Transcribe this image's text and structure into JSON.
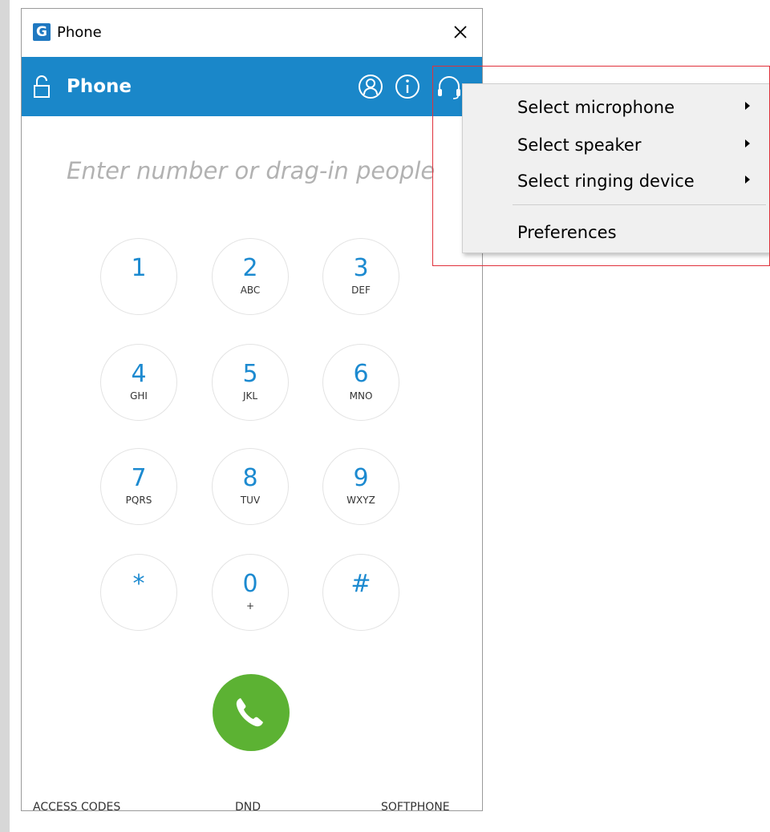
{
  "window": {
    "title": "Phone",
    "logo_letter": "G"
  },
  "header": {
    "title": "Phone",
    "icons": [
      "contacts-icon",
      "info-icon",
      "headset-icon"
    ]
  },
  "dialer": {
    "placeholder": "Enter number or drag-in people",
    "keys": [
      {
        "digit": "1",
        "letters": ""
      },
      {
        "digit": "2",
        "letters": "ABC"
      },
      {
        "digit": "3",
        "letters": "DEF"
      },
      {
        "digit": "4",
        "letters": "GHI"
      },
      {
        "digit": "5",
        "letters": "JKL"
      },
      {
        "digit": "6",
        "letters": "MNO"
      },
      {
        "digit": "7",
        "letters": "PQRS"
      },
      {
        "digit": "8",
        "letters": "TUV"
      },
      {
        "digit": "9",
        "letters": "WXYZ"
      },
      {
        "digit": "*",
        "letters": ""
      },
      {
        "digit": "0",
        "letters": "+"
      },
      {
        "digit": "#",
        "letters": ""
      }
    ]
  },
  "footer": {
    "access_codes": "ACCESS CODES",
    "dnd": "DND",
    "softphone": "SOFTPHONE"
  },
  "context_menu": {
    "items": [
      {
        "label": "Select microphone",
        "submenu": true
      },
      {
        "label": "Select speaker",
        "submenu": true
      },
      {
        "label": "Select ringing device",
        "submenu": true
      },
      {
        "label": "Preferences",
        "submenu": false
      }
    ]
  },
  "colors": {
    "header_blue": "#1a87c9",
    "digit_blue": "#1c8ad0",
    "call_green": "#5cb233",
    "highlight_red": "#e0313b"
  }
}
